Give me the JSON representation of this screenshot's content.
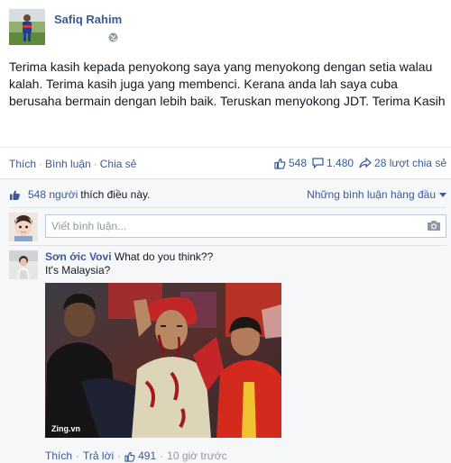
{
  "post": {
    "author": "Safiq Rahim",
    "text": "Terima kasih kepada penyokong saya yang menyokong dengan setia walau kalah. Terima kasih juga yang membenci. Kerana anda lah saya cuba berusaha bermain dengan lebih baik. Teruskan menyokong JDT. Terima Kasih",
    "privacy_icon": "globe-icon"
  },
  "actions": {
    "like": "Thích",
    "comment": "Bình luận",
    "share": "Chia sẻ",
    "separator": "·"
  },
  "stats": {
    "likes": "548",
    "comments": "1.480",
    "shares": "28 lượt chia sẻ"
  },
  "ufi": {
    "likes_count": "548 người",
    "likes_text": "thích điều này.",
    "ordering": "Những bình luận hàng đầu",
    "comment_placeholder": "Viết bình luận..."
  },
  "comment": {
    "author": "Sơn ớic Vovi",
    "text_line1": "What do you think??",
    "text_line2": "It's Malaysia?",
    "photo_watermark": "Zing.vn",
    "like_label": "Thích",
    "reply_label": "Trả lời",
    "likes": "491",
    "time": "10 giờ trước"
  },
  "colors": {
    "link": "#3b5998",
    "text": "#141823",
    "muted": "#9197a3",
    "ufi_bg": "#f6f7f8"
  }
}
